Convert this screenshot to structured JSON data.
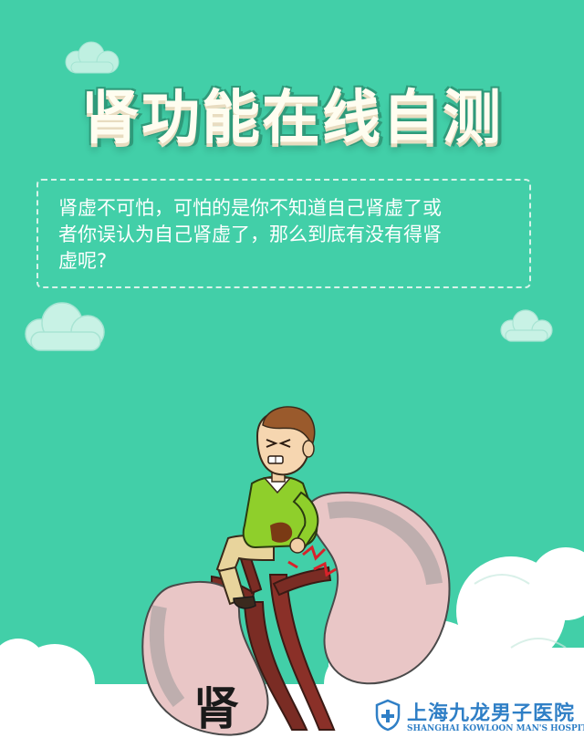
{
  "title": "肾功能在线自测",
  "intro": {
    "line1": "肾虚不可怕，可怕的是你不知道自己肾虚了或",
    "line2": "者你误认为自己肾虚了，那么到底有没有得肾",
    "line3": "虚呢?"
  },
  "illustration": {
    "caption": "肾"
  },
  "logo": {
    "name": "上海九龙男子医院",
    "subtitle": "SHANGHAI KOWLOON MAN'S HOSPITAL",
    "icon": "shield-cross-icon"
  },
  "colors": {
    "background": "#42cfa8",
    "title_fill": "#fffdf0",
    "text": "#ffffff",
    "logo": "#2f7fc6",
    "kidney": "#e9c6c6",
    "kidney_rim": "#8f8f8f"
  }
}
